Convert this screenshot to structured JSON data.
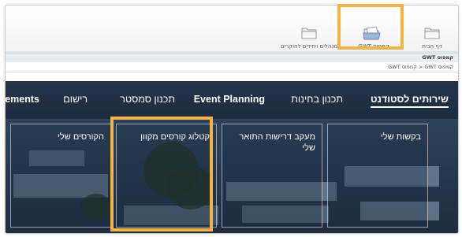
{
  "toolbar": {
    "items": [
      {
        "label": "דף הבית",
        "icon": "folder-icon"
      },
      {
        "label": "קמפוס GWT",
        "icon": "folder-open-icon"
      },
      {
        "label": "מנהלים ויחידים לחוקרים",
        "icon": "folder-icon"
      }
    ]
  },
  "breadcrumb": {
    "section_title": "קמפוס GWT",
    "path": "קמפוס GWT  <  קמפוס GWT"
  },
  "nav": {
    "items": [
      {
        "label": "שירותים לסטודנט"
      },
      {
        "label": "תכנון בחינות"
      },
      {
        "label": "Event Planning"
      },
      {
        "label": "תכנון סמסטר"
      },
      {
        "label": "רישום"
      },
      {
        "label": "ements"
      }
    ]
  },
  "cards": [
    {
      "label": "בקשות שלי"
    },
    {
      "label": "מעקב דרישות התואר שלי"
    },
    {
      "label": "קטלוג קורסים מקוון"
    },
    {
      "label": "הקורסים שלי"
    }
  ],
  "colors": {
    "highlight": "#f4b342",
    "nav_bg": "#24344a"
  }
}
